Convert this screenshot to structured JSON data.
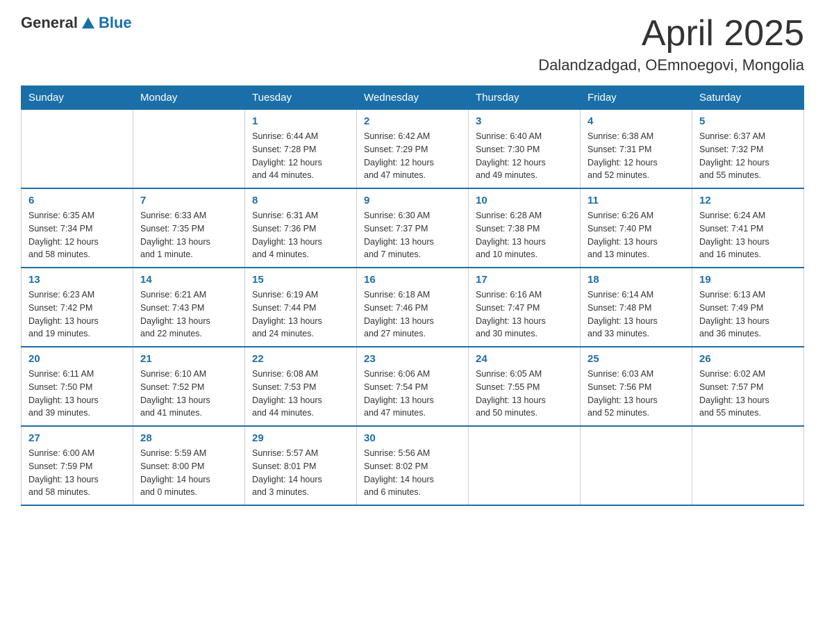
{
  "header": {
    "logo_general": "General",
    "logo_blue": "Blue",
    "month_title": "April 2025",
    "location": "Dalandzadgad, OEmnoegovi, Mongolia"
  },
  "weekdays": [
    "Sunday",
    "Monday",
    "Tuesday",
    "Wednesday",
    "Thursday",
    "Friday",
    "Saturday"
  ],
  "weeks": [
    [
      {
        "day": "",
        "info": ""
      },
      {
        "day": "",
        "info": ""
      },
      {
        "day": "1",
        "info": "Sunrise: 6:44 AM\nSunset: 7:28 PM\nDaylight: 12 hours\nand 44 minutes."
      },
      {
        "day": "2",
        "info": "Sunrise: 6:42 AM\nSunset: 7:29 PM\nDaylight: 12 hours\nand 47 minutes."
      },
      {
        "day": "3",
        "info": "Sunrise: 6:40 AM\nSunset: 7:30 PM\nDaylight: 12 hours\nand 49 minutes."
      },
      {
        "day": "4",
        "info": "Sunrise: 6:38 AM\nSunset: 7:31 PM\nDaylight: 12 hours\nand 52 minutes."
      },
      {
        "day": "5",
        "info": "Sunrise: 6:37 AM\nSunset: 7:32 PM\nDaylight: 12 hours\nand 55 minutes."
      }
    ],
    [
      {
        "day": "6",
        "info": "Sunrise: 6:35 AM\nSunset: 7:34 PM\nDaylight: 12 hours\nand 58 minutes."
      },
      {
        "day": "7",
        "info": "Sunrise: 6:33 AM\nSunset: 7:35 PM\nDaylight: 13 hours\nand 1 minute."
      },
      {
        "day": "8",
        "info": "Sunrise: 6:31 AM\nSunset: 7:36 PM\nDaylight: 13 hours\nand 4 minutes."
      },
      {
        "day": "9",
        "info": "Sunrise: 6:30 AM\nSunset: 7:37 PM\nDaylight: 13 hours\nand 7 minutes."
      },
      {
        "day": "10",
        "info": "Sunrise: 6:28 AM\nSunset: 7:38 PM\nDaylight: 13 hours\nand 10 minutes."
      },
      {
        "day": "11",
        "info": "Sunrise: 6:26 AM\nSunset: 7:40 PM\nDaylight: 13 hours\nand 13 minutes."
      },
      {
        "day": "12",
        "info": "Sunrise: 6:24 AM\nSunset: 7:41 PM\nDaylight: 13 hours\nand 16 minutes."
      }
    ],
    [
      {
        "day": "13",
        "info": "Sunrise: 6:23 AM\nSunset: 7:42 PM\nDaylight: 13 hours\nand 19 minutes."
      },
      {
        "day": "14",
        "info": "Sunrise: 6:21 AM\nSunset: 7:43 PM\nDaylight: 13 hours\nand 22 minutes."
      },
      {
        "day": "15",
        "info": "Sunrise: 6:19 AM\nSunset: 7:44 PM\nDaylight: 13 hours\nand 24 minutes."
      },
      {
        "day": "16",
        "info": "Sunrise: 6:18 AM\nSunset: 7:46 PM\nDaylight: 13 hours\nand 27 minutes."
      },
      {
        "day": "17",
        "info": "Sunrise: 6:16 AM\nSunset: 7:47 PM\nDaylight: 13 hours\nand 30 minutes."
      },
      {
        "day": "18",
        "info": "Sunrise: 6:14 AM\nSunset: 7:48 PM\nDaylight: 13 hours\nand 33 minutes."
      },
      {
        "day": "19",
        "info": "Sunrise: 6:13 AM\nSunset: 7:49 PM\nDaylight: 13 hours\nand 36 minutes."
      }
    ],
    [
      {
        "day": "20",
        "info": "Sunrise: 6:11 AM\nSunset: 7:50 PM\nDaylight: 13 hours\nand 39 minutes."
      },
      {
        "day": "21",
        "info": "Sunrise: 6:10 AM\nSunset: 7:52 PM\nDaylight: 13 hours\nand 41 minutes."
      },
      {
        "day": "22",
        "info": "Sunrise: 6:08 AM\nSunset: 7:53 PM\nDaylight: 13 hours\nand 44 minutes."
      },
      {
        "day": "23",
        "info": "Sunrise: 6:06 AM\nSunset: 7:54 PM\nDaylight: 13 hours\nand 47 minutes."
      },
      {
        "day": "24",
        "info": "Sunrise: 6:05 AM\nSunset: 7:55 PM\nDaylight: 13 hours\nand 50 minutes."
      },
      {
        "day": "25",
        "info": "Sunrise: 6:03 AM\nSunset: 7:56 PM\nDaylight: 13 hours\nand 52 minutes."
      },
      {
        "day": "26",
        "info": "Sunrise: 6:02 AM\nSunset: 7:57 PM\nDaylight: 13 hours\nand 55 minutes."
      }
    ],
    [
      {
        "day": "27",
        "info": "Sunrise: 6:00 AM\nSunset: 7:59 PM\nDaylight: 13 hours\nand 58 minutes."
      },
      {
        "day": "28",
        "info": "Sunrise: 5:59 AM\nSunset: 8:00 PM\nDaylight: 14 hours\nand 0 minutes."
      },
      {
        "day": "29",
        "info": "Sunrise: 5:57 AM\nSunset: 8:01 PM\nDaylight: 14 hours\nand 3 minutes."
      },
      {
        "day": "30",
        "info": "Sunrise: 5:56 AM\nSunset: 8:02 PM\nDaylight: 14 hours\nand 6 minutes."
      },
      {
        "day": "",
        "info": ""
      },
      {
        "day": "",
        "info": ""
      },
      {
        "day": "",
        "info": ""
      }
    ]
  ]
}
